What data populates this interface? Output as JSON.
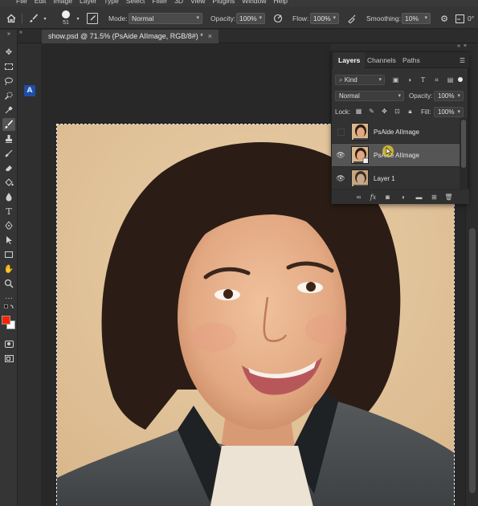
{
  "menu": [
    "File",
    "Edit",
    "Image",
    "Layer",
    "Type",
    "Select",
    "Filter",
    "3D",
    "View",
    "Plugins",
    "Window",
    "Help"
  ],
  "options": {
    "brush_size": "51",
    "mode_label": "Mode:",
    "mode_value": "Normal",
    "opacity_label": "Opacity:",
    "opacity_value": "100%",
    "flow_label": "Flow:",
    "flow_value": "100%",
    "smoothing_label": "Smoothing:",
    "smoothing_value": "10%",
    "angle_value": "0°"
  },
  "document": {
    "tab_title": "show.psd @ 71.5% (PsAide AIImage, RGB/8#) *",
    "close_glyph": "×"
  },
  "plugin": {
    "icon_letter": "A"
  },
  "layers_panel": {
    "tabs": [
      "Layers",
      "Channels",
      "Paths"
    ],
    "active_tab": 0,
    "filter_label": "Kind",
    "blend_mode": "Normal",
    "opacity_label": "Opacity:",
    "opacity_value": "100%",
    "lock_label": "Lock:",
    "fill_label": "Fill:",
    "fill_value": "100%",
    "layers": [
      {
        "name": "PsAide AIImage",
        "visible": false,
        "selected": false
      },
      {
        "name": "PsAide AIImage",
        "visible": true,
        "selected": true
      },
      {
        "name": "Layer 1",
        "visible": true,
        "selected": false
      }
    ],
    "footer_fx": "fx"
  },
  "colors": {
    "foreground": "#ff2200",
    "background": "#ffffff",
    "plugin_accent": "#1e4fa8"
  }
}
